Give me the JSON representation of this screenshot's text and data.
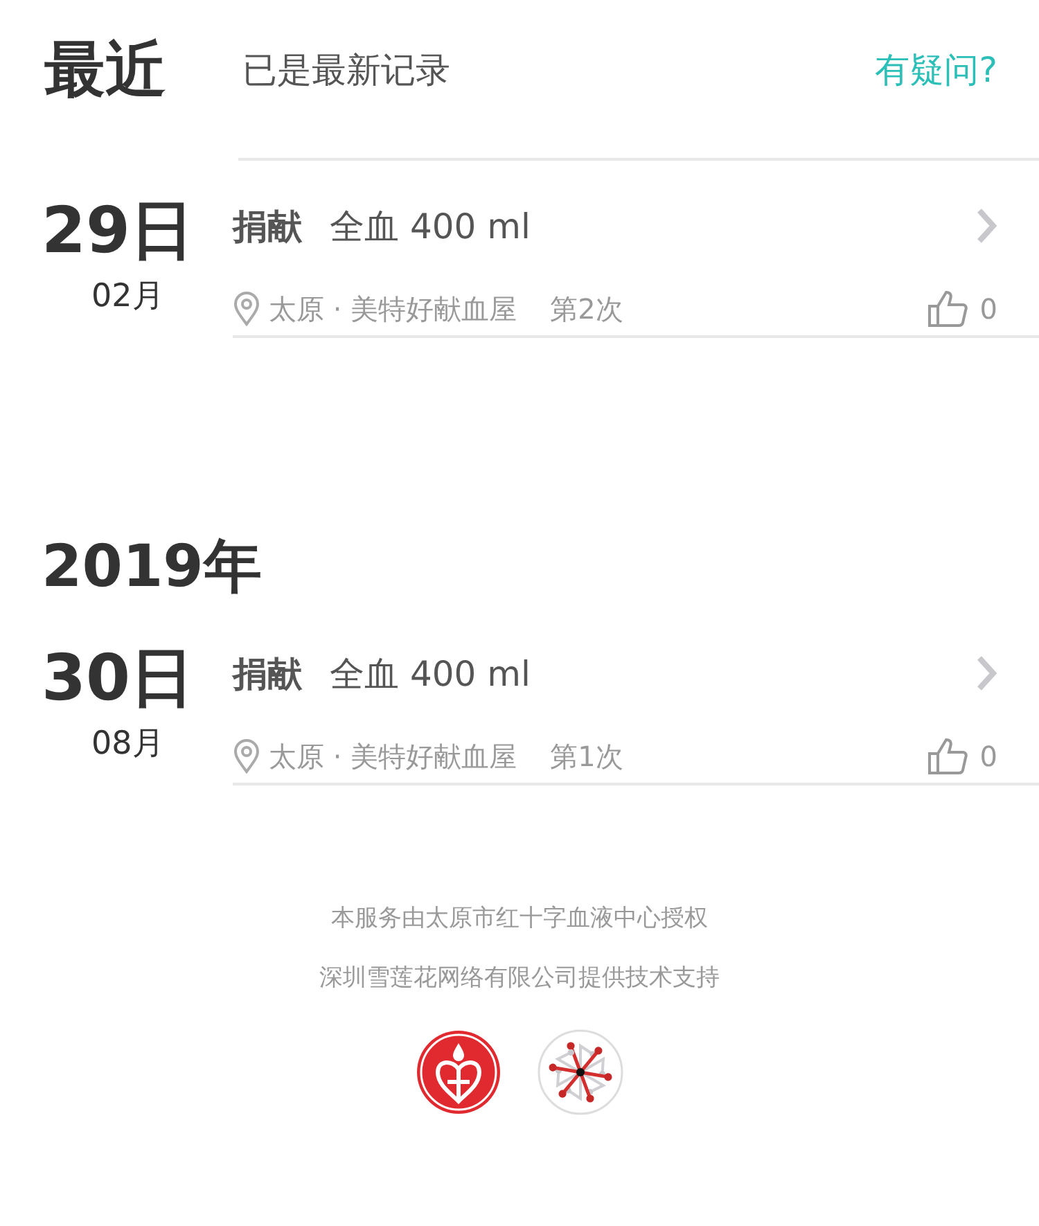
{
  "sections": [
    {
      "heading": "最近",
      "status": "已是最新记录",
      "help_link": "有疑问?",
      "records": [
        {
          "day": "29日",
          "month": "02月",
          "type": "捐献",
          "detail": "全血 400 ml",
          "location": "太原 · 美特好献血屋",
          "count": "第2次",
          "likes": "0"
        }
      ]
    },
    {
      "heading": "2019年",
      "records": [
        {
          "day": "30日",
          "month": "08月",
          "type": "捐献",
          "detail": "全血 400 ml",
          "location": "太原 · 美特好献血屋",
          "count": "第1次",
          "likes": "0"
        }
      ]
    }
  ],
  "footer": {
    "lines": [
      "本服务由太原市红十字血液中心授权",
      "深圳雪莲花网络有限公司提供技术支持"
    ]
  }
}
